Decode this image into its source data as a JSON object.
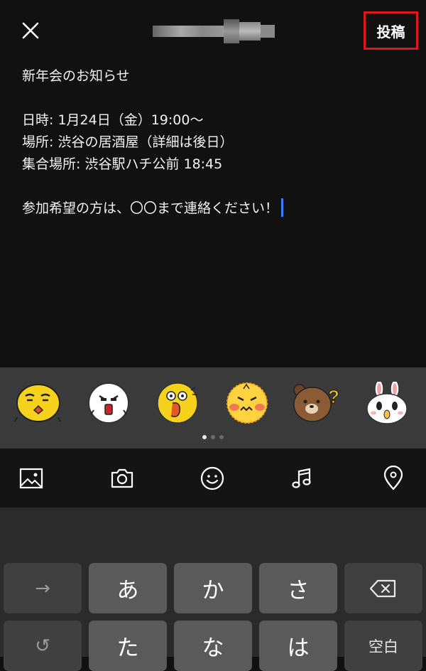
{
  "header": {
    "close_icon": "close-icon",
    "title_blurred": true,
    "post_label": "投稿",
    "post_highlight_color": "#e0161d"
  },
  "compose": {
    "lines": [
      "新年会のお知らせ",
      "",
      "日時: 1月24日（金）19:00～",
      "場所: 渋谷の居酒屋（詳細は後日）",
      "集合場所: 渋谷駅ハチ公前 18:45",
      "",
      "参加希望の方は、〇〇まで連絡ください！"
    ],
    "caret_color": "#3c7bff"
  },
  "stickers": {
    "items": [
      "yellow-smug-face-sticker",
      "sally-shocked-sticker",
      "yellow-yelling-sticker",
      "yellow-angry-blush-sticker",
      "brown-bear-question-sticker",
      "cony-surprised-sticker"
    ],
    "page_count": 3,
    "active_page": 1
  },
  "toolbar": {
    "items": [
      "image-icon",
      "camera-icon",
      "emoji-icon",
      "music-icon",
      "location-pin-icon"
    ]
  },
  "keyboard": {
    "row1": [
      "→",
      "あ",
      "か",
      "さ",
      "⌫"
    ],
    "row2": [
      "↺",
      "た",
      "な",
      "は",
      "空白"
    ]
  }
}
